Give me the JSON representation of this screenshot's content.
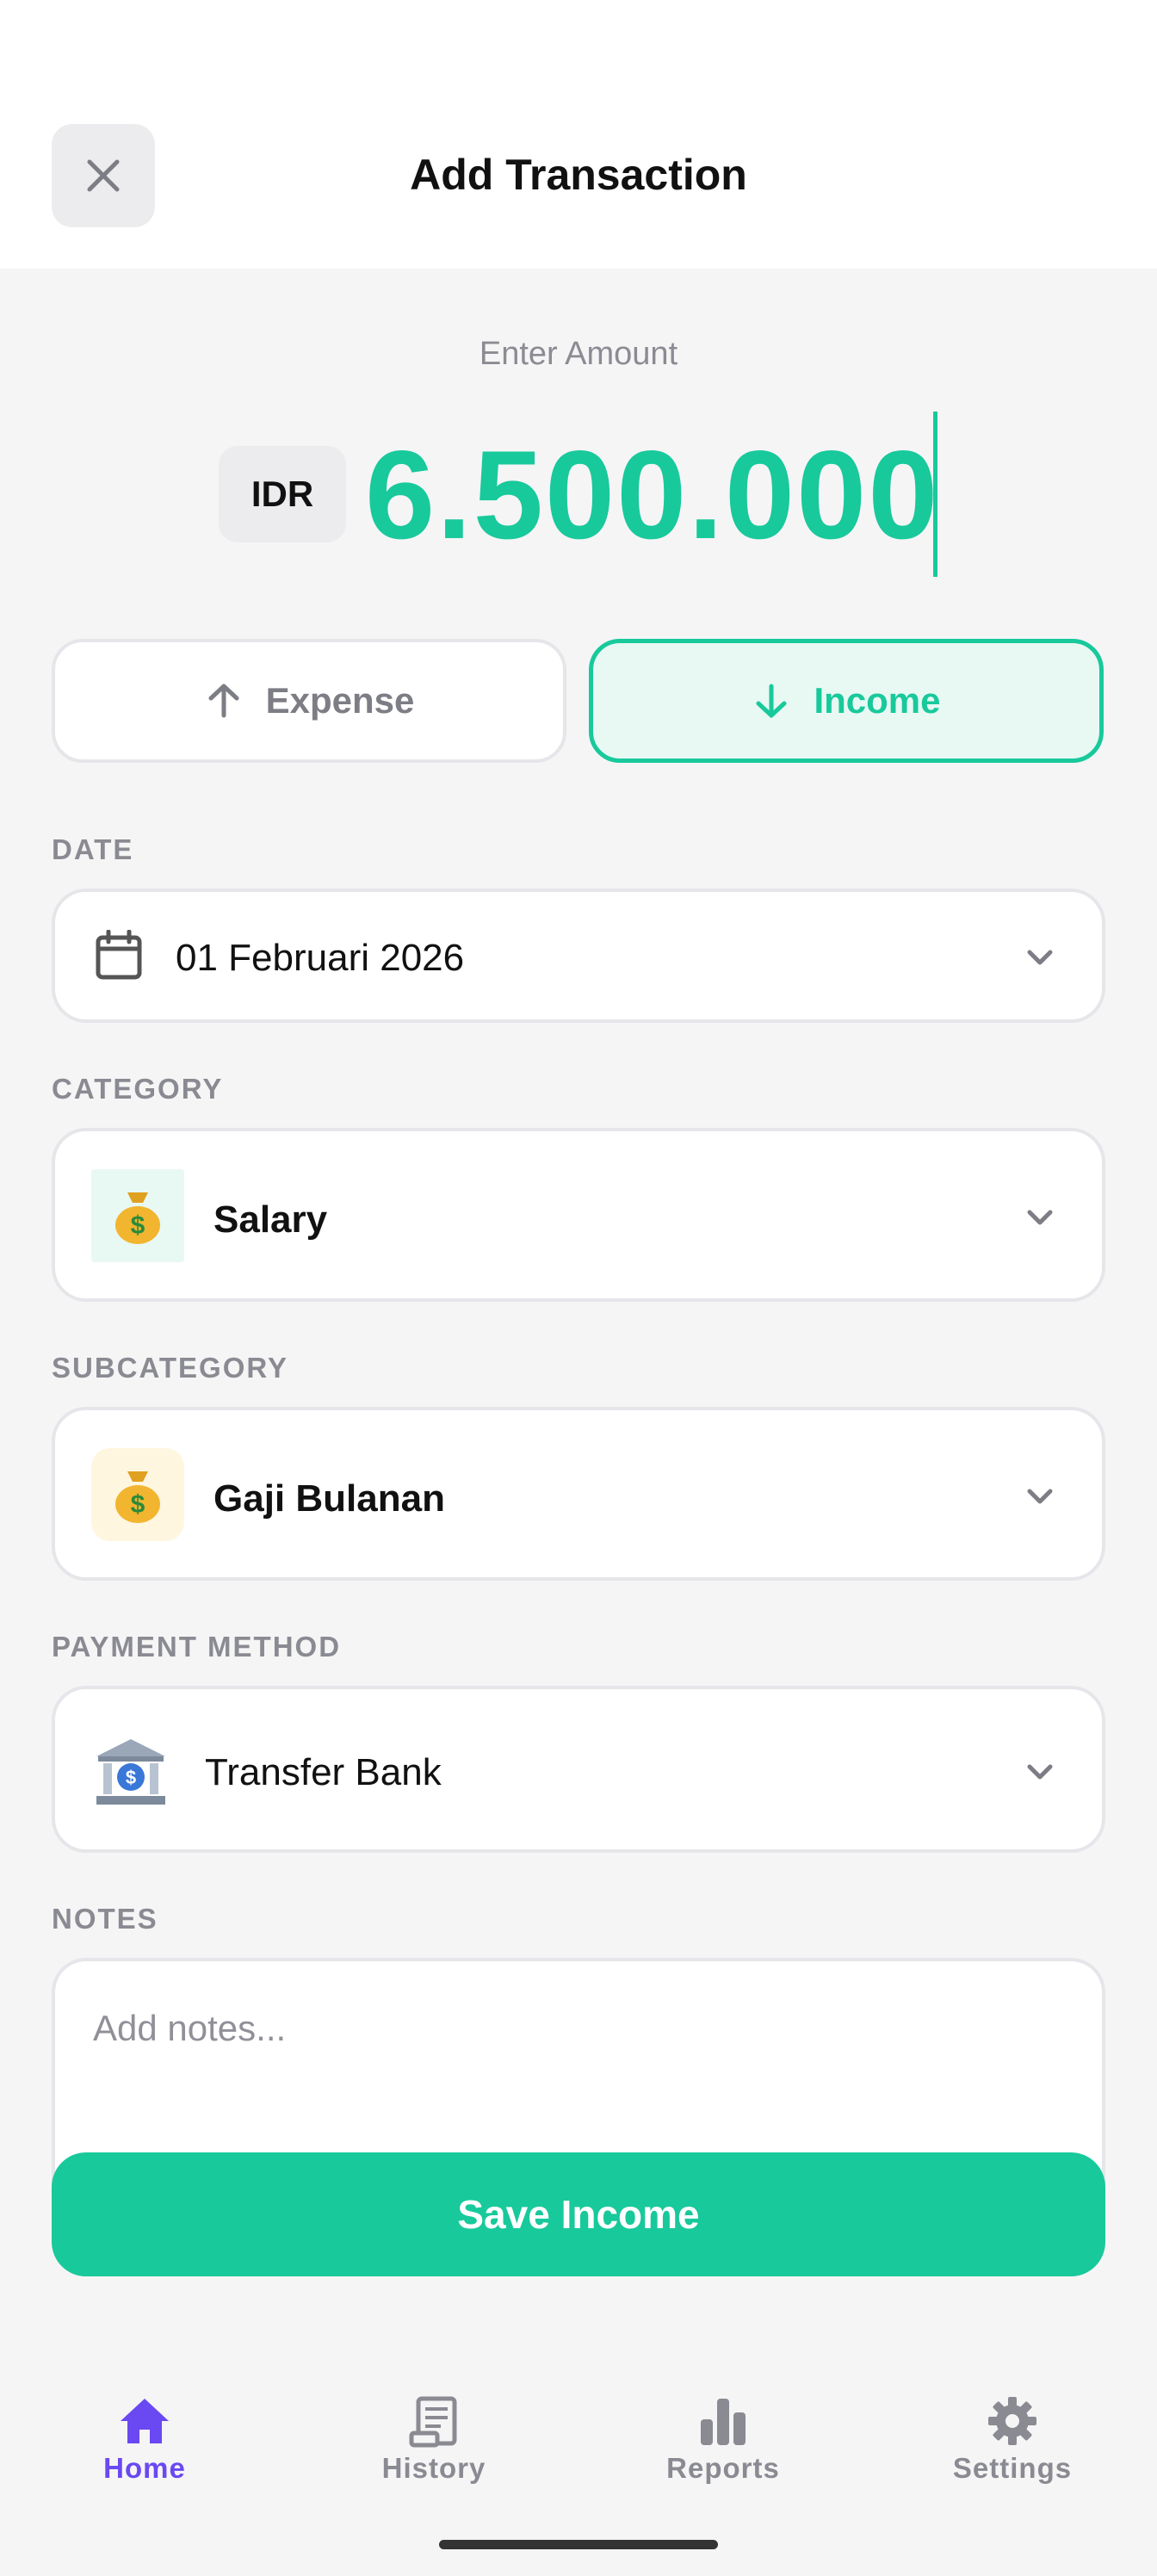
{
  "header": {
    "title": "Add Transaction",
    "close_icon": "close-icon"
  },
  "amount": {
    "label": "Enter Amount",
    "currency": "IDR",
    "value": "6.500.000"
  },
  "type_toggle": {
    "expense_label": "Expense",
    "income_label": "Income",
    "selected": "Income"
  },
  "date": {
    "label": "DATE",
    "value": "01 Februari 2026"
  },
  "category": {
    "label": "CATEGORY",
    "value": "Salary",
    "icon": "money-bag-icon"
  },
  "subcategory": {
    "label": "SUBCATEGORY",
    "value": "Gaji Bulanan",
    "icon": "money-bag-icon"
  },
  "payment_method": {
    "label": "PAYMENT METHOD",
    "value": "Transfer Bank",
    "icon": "bank-icon"
  },
  "notes": {
    "label": "NOTES",
    "placeholder": "Add notes...",
    "value": ""
  },
  "save_button": {
    "label": "Save Income"
  },
  "nav": {
    "items": [
      {
        "label": "Home",
        "icon": "home-icon",
        "active": true
      },
      {
        "label": "History",
        "icon": "receipt-icon",
        "active": false
      },
      {
        "label": "Reports",
        "icon": "bar-chart-icon",
        "active": false
      },
      {
        "label": "Settings",
        "icon": "gear-icon",
        "active": false
      }
    ]
  },
  "colors": {
    "accent": "#18c99b",
    "nav_active": "#6a48f2",
    "muted": "#8a8a92"
  }
}
